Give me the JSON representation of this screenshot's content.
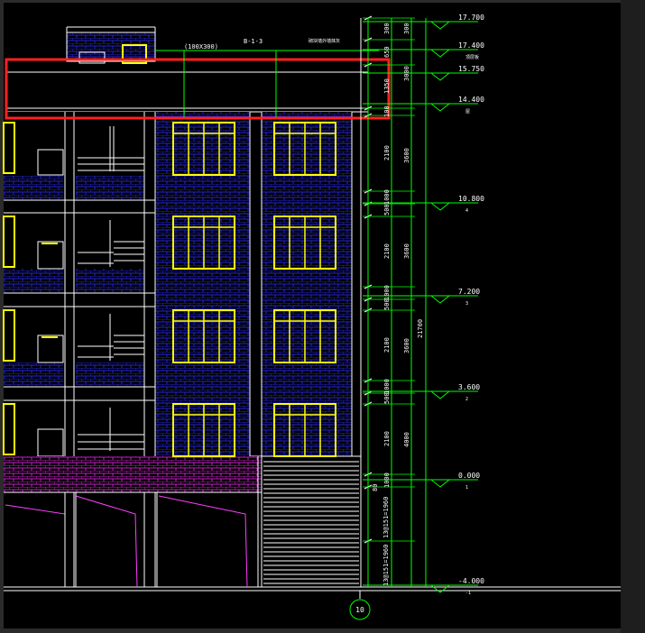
{
  "drawing": {
    "dimension_labels": {
      "window_size": "(100X300)",
      "section_ref": "B-1-3",
      "top_note": "砌块墙外墙抹灰",
      "stair_a": "13@151=1960",
      "stair_b": "13@151=1960",
      "stair_label": "80"
    },
    "elevations": [
      "17.700",
      "17.400",
      "15.750",
      "14.400",
      "10.800",
      "7.200",
      "3.600",
      "0.000",
      "-4.000"
    ],
    "elevation_tags": [
      "",
      "顶层板",
      "",
      "屋",
      "4",
      "3",
      "2",
      "1",
      "-1"
    ],
    "inner_dims": [
      "300",
      "650",
      "1350",
      "100",
      "2100",
      "1000",
      "500",
      "2100",
      "1000",
      "500",
      "2100",
      "1000",
      "500",
      "2100",
      "1000",
      "",
      ""
    ],
    "outer_dims": [
      "300",
      "3000",
      "3600",
      "3600",
      "3600",
      "4000"
    ],
    "total_dim": "21700",
    "axis_label": "10"
  },
  "colors": {
    "background": "#000000",
    "chrome": "#2b2b2b",
    "brick_blue": "#1a1aa8",
    "brick_magenta": "#b21ab2",
    "window": "#ffff00",
    "dimension_green": "#00ff00",
    "annotation_red": "#ff2020"
  }
}
